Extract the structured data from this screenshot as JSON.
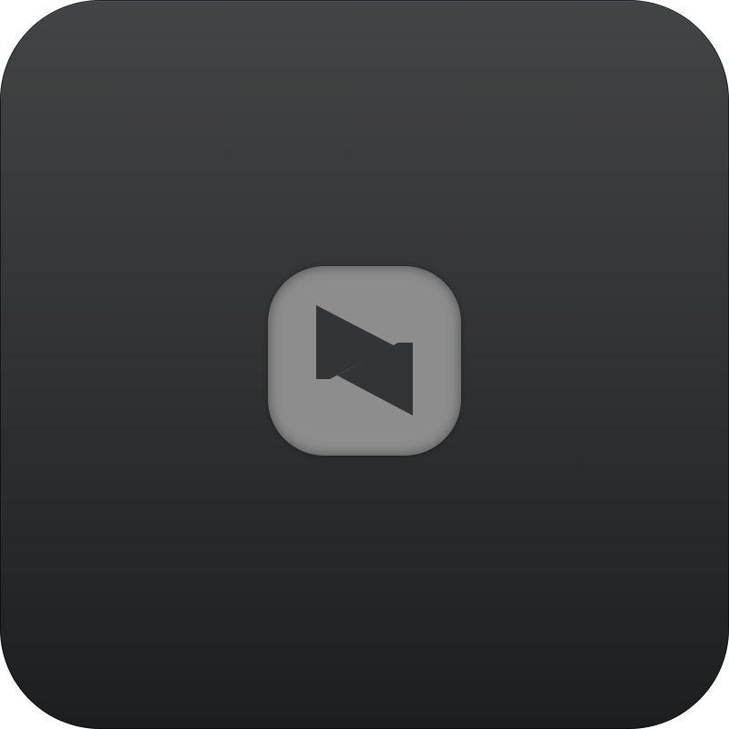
{
  "tile": {
    "icon": "play-and-rewind-icon",
    "background_top": "#434445",
    "background_bottom": "#1d1e1f",
    "badge_color": "#8d8d8d",
    "glyph_color": "#333435"
  }
}
